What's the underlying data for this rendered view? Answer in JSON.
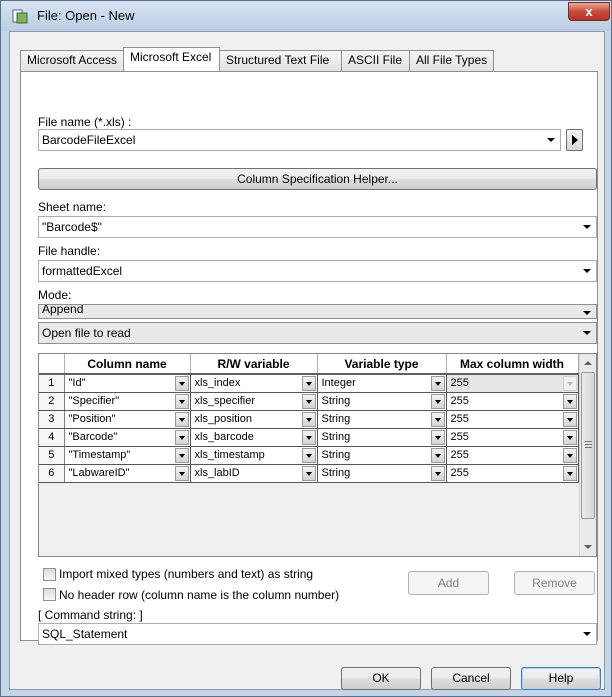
{
  "window": {
    "title": "File: Open - New",
    "close_glyph": "x"
  },
  "tabs": [
    {
      "label": "Microsoft Access",
      "active": false
    },
    {
      "label": "Microsoft Excel",
      "active": true
    },
    {
      "label": "Structured Text File",
      "active": false
    },
    {
      "label": "ASCII File",
      "active": false
    },
    {
      "label": "All File Types",
      "active": false
    }
  ],
  "file_name": {
    "label": "File name (*.xls) :",
    "value": "BarcodeFileExcel"
  },
  "column_spec_button": "Column Specification Helper...",
  "sheet_name": {
    "label": "Sheet name:",
    "value": "\"Barcode$\""
  },
  "file_handle": {
    "label": "File handle:",
    "value": "formattedExcel"
  },
  "mode": {
    "label": "Mode:",
    "value": "Append",
    "open_value": "Open file to read"
  },
  "grid": {
    "headers": [
      "Column name",
      "R/W variable",
      "Variable type",
      "Max column width"
    ],
    "rows": [
      {
        "num": "1",
        "name": "\"Id\"",
        "var": "xls_index",
        "type": "Integer",
        "width": "255"
      },
      {
        "num": "2",
        "name": "\"Specifier\"",
        "var": "xls_specifier",
        "type": "String",
        "width": "255"
      },
      {
        "num": "3",
        "name": "\"Position\"",
        "var": "xls_position",
        "type": "String",
        "width": "255"
      },
      {
        "num": "4",
        "name": "\"Barcode\"",
        "var": "xls_barcode",
        "type": "String",
        "width": "255"
      },
      {
        "num": "5",
        "name": "\"Timestamp\"",
        "var": "xls_timestamp",
        "type": "String",
        "width": "255"
      },
      {
        "num": "6",
        "name": "\"LabwareID\"",
        "var": "xls_labID",
        "type": "String",
        "width": "255"
      }
    ]
  },
  "options": {
    "import_mixed": "Import mixed types (numbers and text) as string",
    "no_header": "No header row (column name is the column number)"
  },
  "add_button": "Add",
  "remove_button": "Remove",
  "command": {
    "label": "[ Command string: ]",
    "value": "SQL_Statement"
  },
  "footer": {
    "ok": "OK",
    "cancel": "Cancel",
    "help": "Help"
  },
  "colors": {
    "title_bar": "#c5d5e8",
    "close_red": "#c94a3a",
    "panel_bg": "#ffffff"
  }
}
